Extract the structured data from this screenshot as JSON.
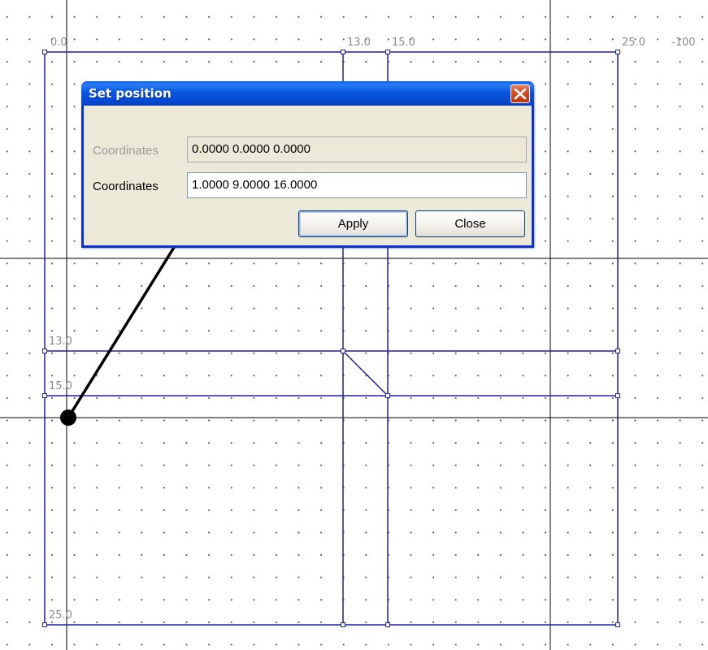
{
  "dialog": {
    "title": "Set position",
    "close_icon": "close-x-icon",
    "rows": [
      {
        "label": "Coordinates",
        "value": "0.0000  0.0000  0.0000",
        "enabled": false
      },
      {
        "label": "Coordinates",
        "value": "1.0000  9.0000  16.0000",
        "enabled": true
      }
    ],
    "apply_label": "Apply",
    "close_label": "Close"
  },
  "canvas": {
    "top_labels": [
      "0.0",
      "13.0",
      "15.0",
      "25.0",
      "-100"
    ],
    "left_labels": [
      "13.0",
      "15.0",
      "25.0"
    ],
    "annotation": "arrow-annotation",
    "pointer_marker": "point-marker"
  },
  "colors": {
    "model_lines": "#1f1fa8",
    "axis_lines": "#000000",
    "dialog_title": "#0a58e0",
    "dialog_body": "#ece9d8",
    "disabled_text": "#9a9a9a"
  }
}
